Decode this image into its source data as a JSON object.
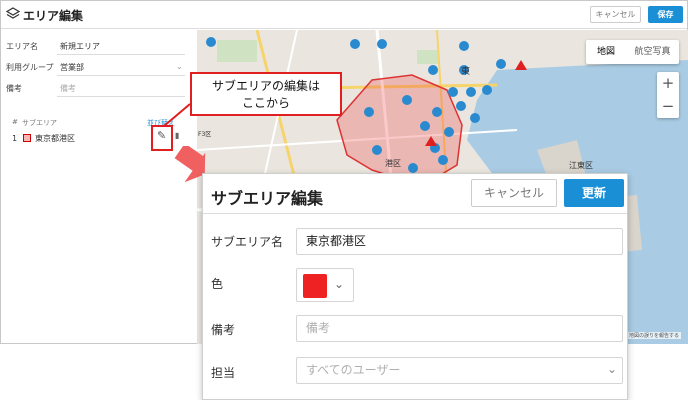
{
  "header": {
    "title": "エリア編集",
    "cancel_label": "キャンセル",
    "save_label": "保存"
  },
  "form": {
    "area_name_label": "エリア名",
    "area_name_value": "新規エリア",
    "group_label": "利用グループ",
    "group_value": "営業部",
    "note_label": "備考",
    "note_placeholder": "備考"
  },
  "subarea_table": {
    "col_num": "#",
    "col_name": "サブエリア",
    "action_label": "並び替え",
    "rows": [
      {
        "num": "1",
        "name": "東京都港区",
        "color": "#ee2222"
      }
    ]
  },
  "map": {
    "type_map": "地図",
    "type_satellite": "航空写真",
    "zoom_in": "+",
    "zoom_out": "−",
    "labels": {
      "minato": "港区",
      "koto": "江東区",
      "f3": "F3区",
      "koto_small": "区",
      "higashi": "東"
    },
    "footer": "地図の誤りを報告する"
  },
  "annotation": {
    "line1": "サブエリアの編集は",
    "line2": "ここから"
  },
  "dialog": {
    "title": "サブエリア編集",
    "cancel_label": "キャンセル",
    "update_label": "更新",
    "name_label": "サブエリア名",
    "name_value": "東京都港区",
    "color_label": "色",
    "color_value": "#ee2222",
    "note_label": "備考",
    "note_placeholder": "備考",
    "assignee_label": "担当",
    "assignee_placeholder": "すべてのユーザー"
  },
  "colors": {
    "accent": "#1a8fd6",
    "highlight": "#e02020",
    "area_fill": "#f4b6b6"
  }
}
